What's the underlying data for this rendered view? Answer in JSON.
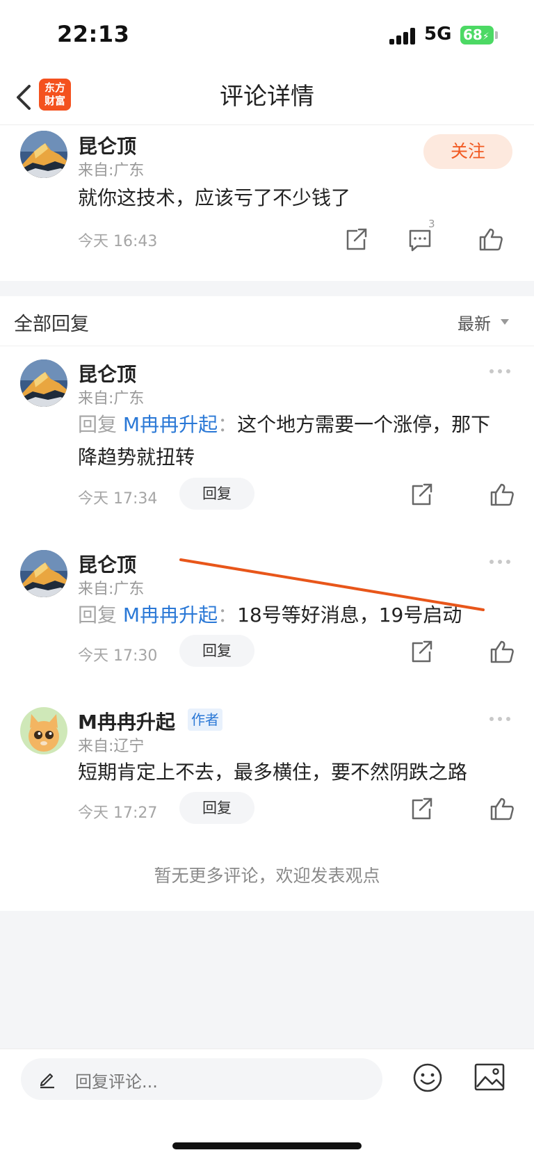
{
  "status_bar": {
    "time": "22:13",
    "network": "5G",
    "battery": "68"
  },
  "header": {
    "title": "评论详情",
    "logo_line1": "东方",
    "logo_line2": "财富"
  },
  "main_comment": {
    "username": "昆仑顶",
    "location": "来自:广东",
    "follow_label": "关注",
    "content": "就你这技术，应该亏了不少钱了",
    "time": "今天 16:43",
    "comment_count": "3"
  },
  "replies_header": {
    "title": "全部回复",
    "sort": "最新"
  },
  "replies": [
    {
      "username": "昆仑顶",
      "location": "来自:广东",
      "reply_prefix": "回复",
      "reply_target": "M冉冉升起",
      "reply_colon": "：",
      "content": "这个地方需要一个涨停，那下降趋势就扭转",
      "time": "今天 17:34",
      "reply_label": "回复"
    },
    {
      "username": "昆仑顶",
      "location": "来自:广东",
      "reply_prefix": "回复",
      "reply_target": "M冉冉升起",
      "reply_colon": "：",
      "content": "18号等好消息，19号启动",
      "time": "今天 17:30",
      "reply_label": "回复"
    },
    {
      "username": "M冉冉升起",
      "badge": "作者",
      "location": "来自:辽宁",
      "content": "短期肯定上不去，最多横住，要不然阴跌之路",
      "time": "今天 17:27",
      "reply_label": "回复"
    }
  ],
  "end_note": "暂无更多评论，欢迎发表观点",
  "bottom_bar": {
    "input_placeholder": "回复评论..."
  },
  "colors": {
    "accent_orange": "#f15a22",
    "link_blue": "#2a78d6",
    "annotation_line": "#e8561a"
  },
  "icons": [
    "back-arrow-icon",
    "share-icon",
    "comment-icon",
    "thumbs-up-icon",
    "more-dots-icon",
    "pen-icon",
    "emoji-icon",
    "image-icon"
  ]
}
